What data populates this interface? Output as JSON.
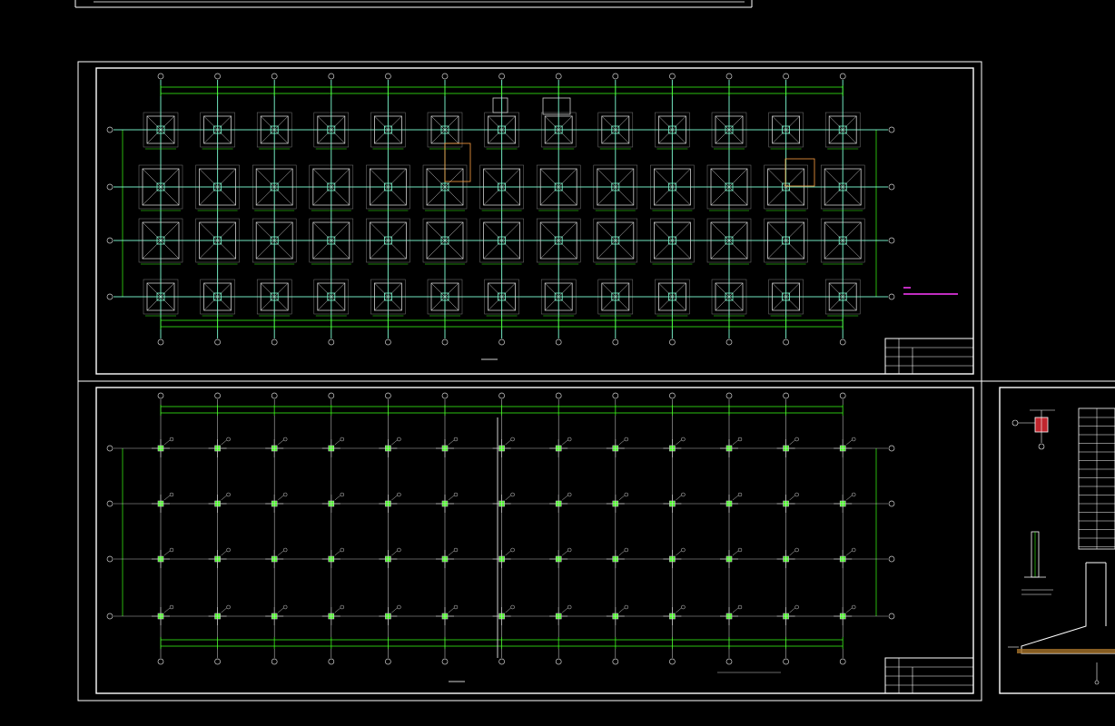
{
  "window": {
    "title": ""
  },
  "colors": {
    "background": "#000000",
    "frame": "#ffffff",
    "axis": "#7fffd4",
    "column": "#cfcfcf",
    "dimension": "#39ff14",
    "note": "#ff3cff",
    "fill_red": "#c0262e",
    "soil": "#a8742b"
  },
  "sheets": [
    {
      "id": "foundation-plan",
      "title_block": {
        "rows": 4
      }
    },
    {
      "id": "column-layout-plan",
      "title_block": {
        "rows": 4
      }
    },
    {
      "id": "detail-sheet",
      "title_block": {
        "rows": 0
      }
    }
  ],
  "grid": {
    "columns": 13,
    "rows": 4
  },
  "icons": {
    "footing": "square-with-diagonals-icon",
    "column": "cross-marker-icon",
    "axis_bubble": "circle-icon"
  }
}
